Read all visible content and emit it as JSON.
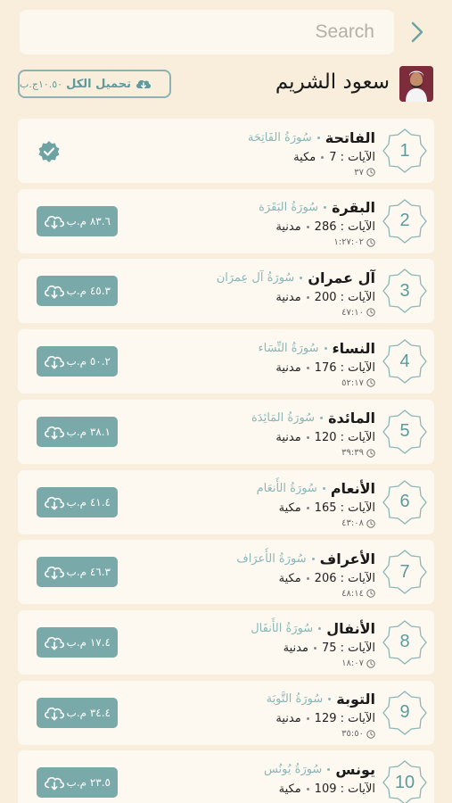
{
  "search": {
    "placeholder": "Search"
  },
  "reciter": {
    "name": "سعود الشريم"
  },
  "download_all": {
    "label": "تحميل الكل",
    "size": "١٠.٥٠ج.ب"
  },
  "colors": {
    "accent": "#7aa9aa",
    "background": "#f8eedb",
    "card": "#fdf9f1"
  },
  "surahs": [
    {
      "number": "1",
      "name": "الفاتحة",
      "calligraphy": "سُورَةُ الفَاتِحَة",
      "ayat": "الآيات : 7",
      "type": "مكية",
      "duration": "٣٧",
      "download": "",
      "downloaded": true
    },
    {
      "number": "2",
      "name": "البقرة",
      "calligraphy": "سُورَةُ البَقَرَة",
      "ayat": "الآيات : 286",
      "type": "مدنية",
      "duration": "١:٢٧:٠٢",
      "download": "٨٣.٦ م.ب",
      "downloaded": false
    },
    {
      "number": "3",
      "name": "آل عمران",
      "calligraphy": "سُورَةُ آل عِمرَان",
      "ayat": "الآيات : 200",
      "type": "مدنية",
      "duration": "٤٧:١٠",
      "download": "٤٥.٣ م.ب",
      "downloaded": false
    },
    {
      "number": "4",
      "name": "النساء",
      "calligraphy": "سُورَةُ النِّسَاء",
      "ayat": "الآيات : 176",
      "type": "مدنية",
      "duration": "٥٢:١٧",
      "download": "٥٠.٢ م.ب",
      "downloaded": false
    },
    {
      "number": "5",
      "name": "المائدة",
      "calligraphy": "سُورَةُ المَائِدَة",
      "ayat": "الآيات : 120",
      "type": "مدنية",
      "duration": "٣٩:٣٩",
      "download": "٣٨.١ م.ب",
      "downloaded": false
    },
    {
      "number": "6",
      "name": "الأنعام",
      "calligraphy": "سُورَةُ الأَنعَام",
      "ayat": "الآيات : 165",
      "type": "مكية",
      "duration": "٤٣:٠٨",
      "download": "٤١.٤ م.ب",
      "downloaded": false
    },
    {
      "number": "7",
      "name": "الأعراف",
      "calligraphy": "سُورَةُ الأَعرَاف",
      "ayat": "الآيات : 206",
      "type": "مكية",
      "duration": "٤٨:١٤",
      "download": "٤٦.٣ م.ب",
      "downloaded": false
    },
    {
      "number": "8",
      "name": "الأنفال",
      "calligraphy": "سُورَةُ الأَنفَال",
      "ayat": "الآيات : 75",
      "type": "مدنية",
      "duration": "١٨:٠٧",
      "download": "١٧.٤ م.ب",
      "downloaded": false
    },
    {
      "number": "9",
      "name": "التوبة",
      "calligraphy": "سُورَةُ التَّوبَة",
      "ayat": "الآيات : 129",
      "type": "مدنية",
      "duration": "٣٥:٥٠",
      "download": "٣٤.٤ م.ب",
      "downloaded": false
    },
    {
      "number": "10",
      "name": "يونس",
      "calligraphy": "سُورَةُ يُونُس",
      "ayat": "الآيات : 109",
      "type": "مكية",
      "duration": "",
      "download": "٢٣.٥ م.ب",
      "downloaded": false
    }
  ]
}
